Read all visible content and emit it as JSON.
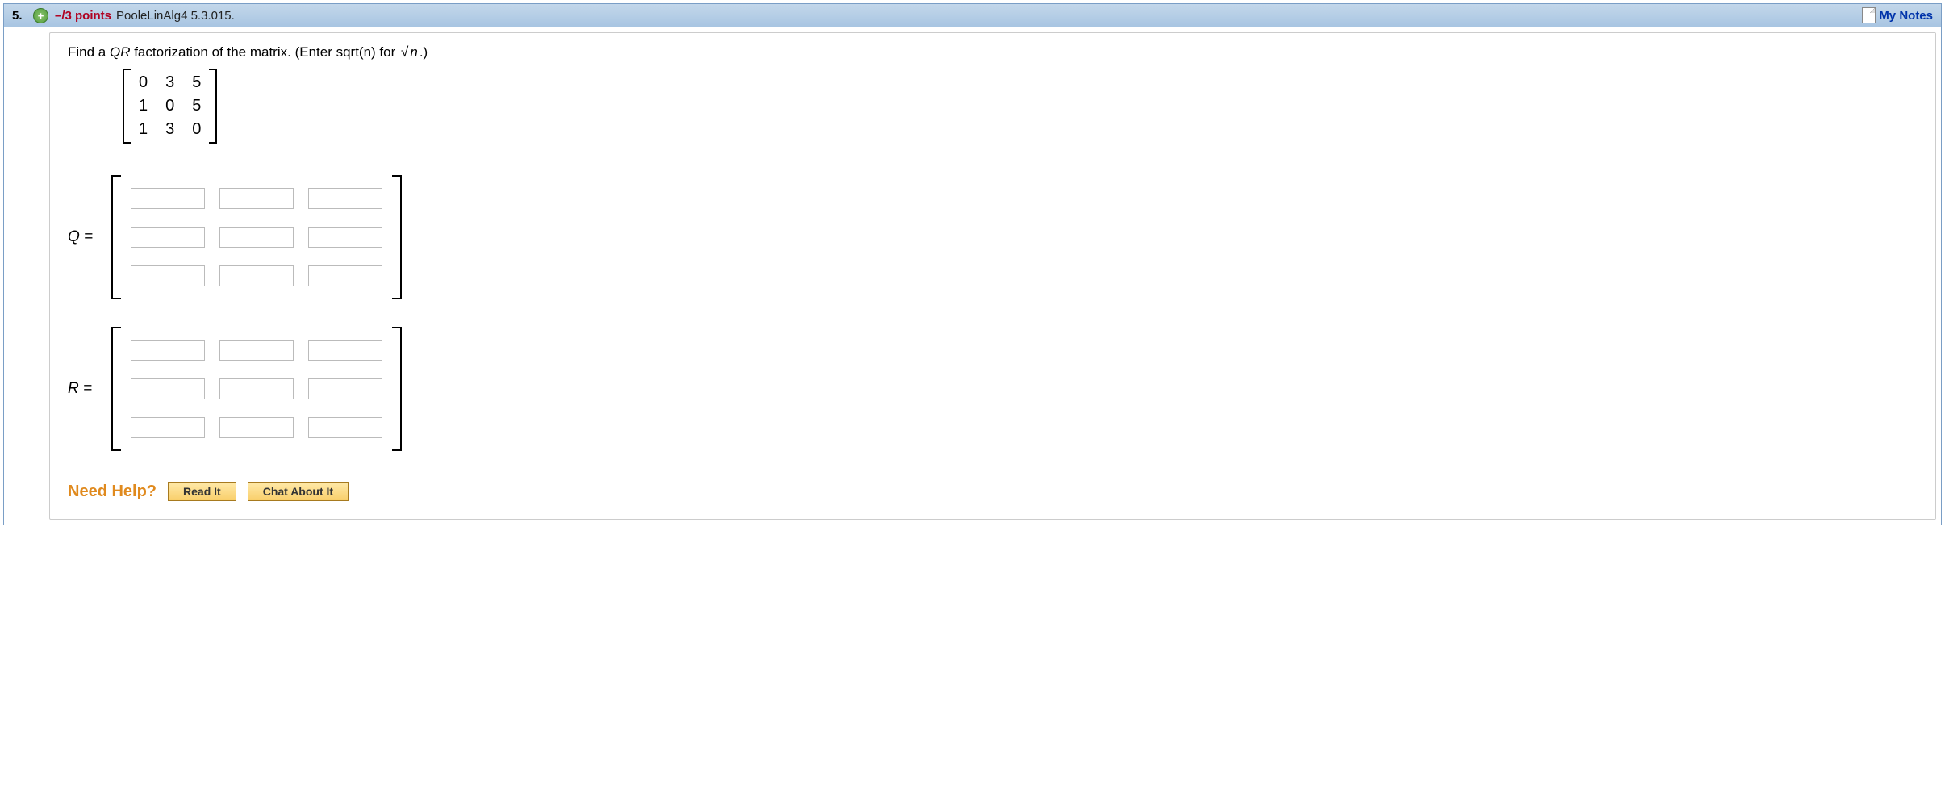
{
  "header": {
    "question_number": "5.",
    "expand_glyph": "+",
    "points": "–/3 points",
    "source": "PooleLinAlg4 5.3.015.",
    "my_notes": "My Notes"
  },
  "prompt": {
    "lead": "Find a ",
    "qr": "QR",
    "mid": " factorization of the matrix. (Enter sqrt(n) for ",
    "sqrt_arg": "n",
    "tail": ".)"
  },
  "matrix": {
    "r1c1": "0",
    "r1c2": "3",
    "r1c3": "5",
    "r2c1": "1",
    "r2c2": "0",
    "r2c3": "5",
    "r3c1": "1",
    "r3c2": "3",
    "r3c3": "0"
  },
  "labels": {
    "Q": "Q =",
    "R": "R ="
  },
  "help": {
    "title": "Need Help?",
    "read": "Read It",
    "chat": "Chat About It"
  }
}
